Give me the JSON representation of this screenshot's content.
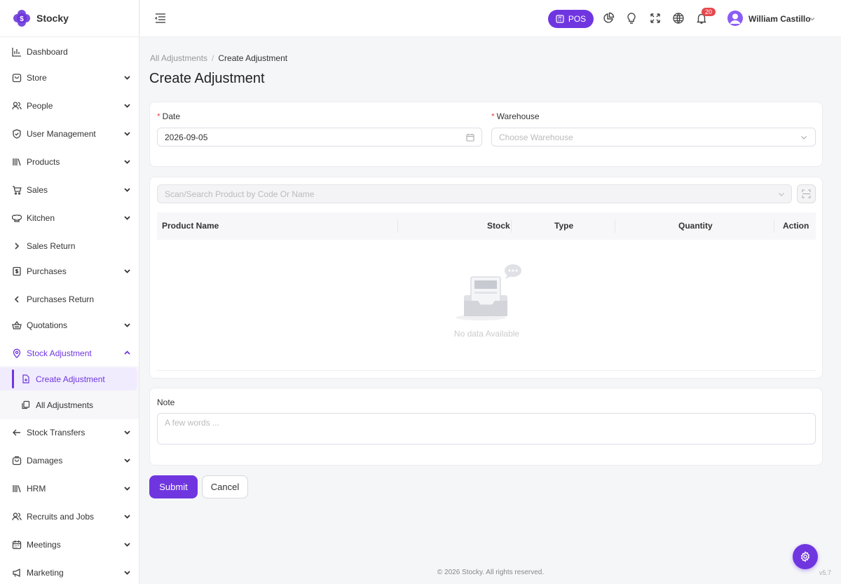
{
  "brand": {
    "name": "Stocky"
  },
  "sidebar": {
    "items": [
      {
        "label": "Dashboard",
        "icon": "bar-chart-icon"
      },
      {
        "label": "Store",
        "icon": "store-icon"
      },
      {
        "label": "People",
        "icon": "people-icon"
      },
      {
        "label": "User Management",
        "icon": "shield-icon"
      },
      {
        "label": "Products",
        "icon": "books-icon"
      },
      {
        "label": "Sales",
        "icon": "cart-icon"
      },
      {
        "label": "Kitchen",
        "icon": "chef-hat-icon"
      },
      {
        "label": "Sales Return",
        "icon": "chevron-right-icon"
      },
      {
        "label": "Purchases",
        "icon": "receipt-icon"
      },
      {
        "label": "Purchases Return",
        "icon": "chevron-left-icon"
      },
      {
        "label": "Quotations",
        "icon": "basket-icon"
      },
      {
        "label": "Stock Adjustment",
        "icon": "location-pin-icon"
      },
      {
        "label": "Stock Transfers",
        "icon": "arrow-left-icon"
      },
      {
        "label": "Damages",
        "icon": "bag-icon"
      },
      {
        "label": "HRM",
        "icon": "library-icon"
      },
      {
        "label": "Recruits and Jobs",
        "icon": "people-icon"
      },
      {
        "label": "Meetings",
        "icon": "calendar-icon"
      },
      {
        "label": "Marketing",
        "icon": "megaphone-icon"
      }
    ],
    "sub_items": [
      {
        "label": "Create Adjustment",
        "icon": "file-plus-icon"
      },
      {
        "label": "All Adjustments",
        "icon": "copy-icon"
      }
    ]
  },
  "header": {
    "pos_label": "POS",
    "notification_count": "20",
    "user_name": "William Castillo"
  },
  "breadcrumb": {
    "parent": "All Adjustments",
    "separator": "/",
    "current": "Create Adjustment"
  },
  "page_title": "Create Adjustment",
  "form": {
    "date_label": "Date",
    "date_value": "2026-09-05",
    "warehouse_label": "Warehouse",
    "warehouse_placeholder": "Choose Warehouse",
    "search_placeholder": "Scan/Search Product by Code Or Name",
    "table_headers": [
      "Product Name",
      "Stock",
      "Type",
      "Quantity",
      "Action"
    ],
    "empty_text": "No data Available",
    "note_label": "Note",
    "note_placeholder": "A few words ...",
    "submit_label": "Submit",
    "cancel_label": "Cancel"
  },
  "footer": {
    "copyright": "© 2026 Stocky. All rights reserved.",
    "version": "v5.7"
  },
  "colors": {
    "accent": "#6f36e0",
    "badge": "#e5484d"
  }
}
